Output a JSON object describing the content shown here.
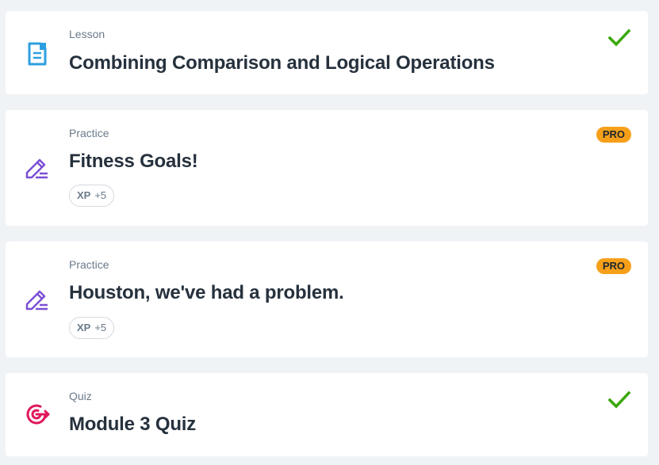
{
  "colors": {
    "background": "#f0f3f6",
    "card": "#ffffff",
    "title_text": "#26313d",
    "type_text": "#6b7a8a",
    "check_green": "#3aa70a",
    "pro_badge": "#f6a01a",
    "lesson_icon": "#2d9fe0",
    "practice_icon": "#7b4fd4",
    "quiz_icon": "#e0175c"
  },
  "items": [
    {
      "type": "Lesson",
      "title": "Combining Comparison and Logical Operations",
      "icon": "lesson-document-icon",
      "completed": true
    },
    {
      "type": "Practice",
      "title": "Fitness Goals!",
      "icon": "pencil-icon",
      "badge": "PRO",
      "xp_label": "XP",
      "xp_value": "+5"
    },
    {
      "type": "Practice",
      "title": "Houston, we've had a problem.",
      "icon": "pencil-icon",
      "badge": "PRO",
      "xp_label": "XP",
      "xp_value": "+5"
    },
    {
      "type": "Quiz",
      "title": "Module 3 Quiz",
      "icon": "target-icon",
      "completed": true
    }
  ]
}
